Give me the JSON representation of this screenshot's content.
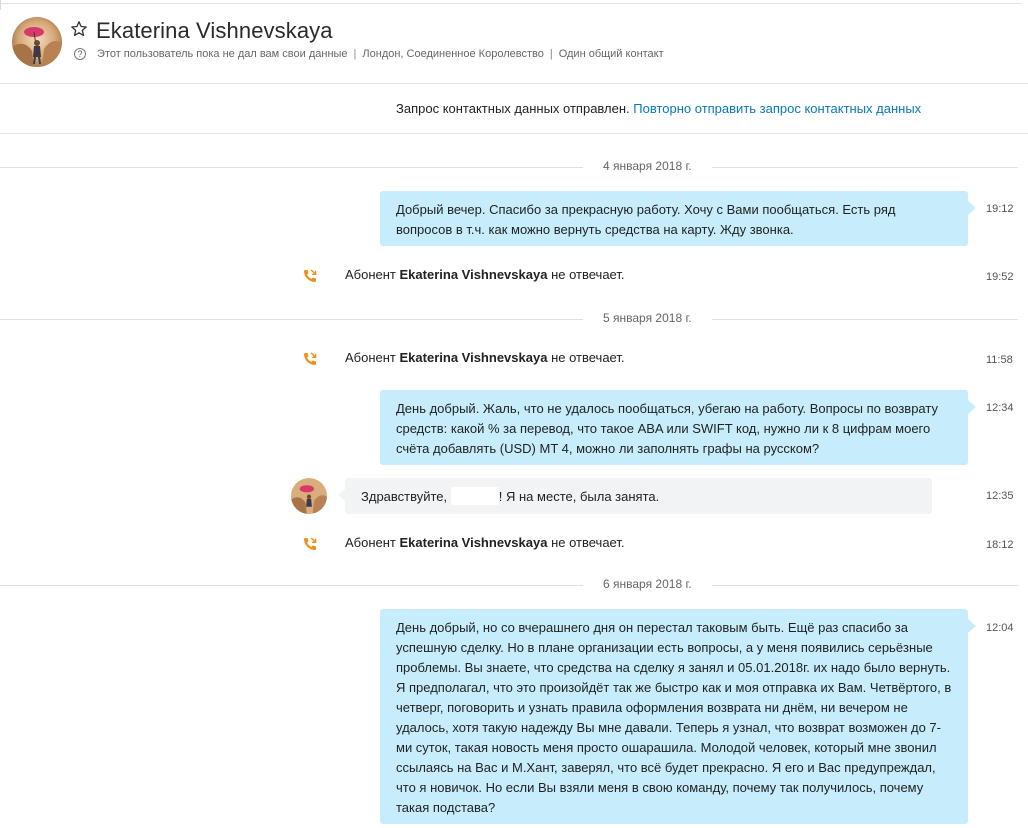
{
  "header": {
    "contact_name": "Ekaterina Vishnevskaya",
    "meta": {
      "privacy": "Этот пользователь пока не дал вам свои данные",
      "location": "Лондон, Соединенное Королевство",
      "shared": "Один общий контакт",
      "separator": "|"
    }
  },
  "request": {
    "status": "Запрос контактных данных отправлен.",
    "resend_link": "Повторно отправить запрос контактных данных"
  },
  "dates": [
    "4 января 2018 г.",
    "5 января 2018 г.",
    "6 января 2018 г."
  ],
  "messages": [
    {
      "type": "out",
      "text": "Добрый вечер. Спасибо за прекрасную работу. Хочу с Вами пообщаться. Есть ряд вопросов в т.ч.  как можно вернуть средства на карту. Жду звонка.",
      "time": "19:12"
    },
    {
      "type": "call",
      "prefix": "Абонент",
      "name": "Ekaterina Vishnevskaya",
      "suffix": "не отвечает.",
      "time": "19:52"
    },
    {
      "type": "call",
      "prefix": "Абонент",
      "name": "Ekaterina Vishnevskaya",
      "suffix": "не отвечает.",
      "time": "11:58"
    },
    {
      "type": "out",
      "text": "День добрый. Жаль, что не удалось пообщаться, убегаю на работу. Вопросы по возврату средств: какой % за перевод, что такое ABA или SWIFT код, нужно ли к 8 цифрам моего счёта добавлять (USD) MT 4, можно ли заполнять графы на русском?",
      "time": "12:34"
    },
    {
      "type": "in",
      "text_before": "Здравствуйте,",
      "text_after": "! Я на месте, была занята.",
      "time": "12:35"
    },
    {
      "type": "call",
      "prefix": "Абонент",
      "name": "Ekaterina Vishnevskaya",
      "suffix": "не отвечает.",
      "time": "18:12"
    },
    {
      "type": "out",
      "text": "День добрый, но со вчерашнего дня он перестал таковым быть. Ещё раз спасибо за успешную сделку. Но в плане организации есть вопросы, а у меня появились серьёзные проблемы. Вы знаете, что средства на сделку я занял и 05.01.2018г. их надо было вернуть. Я предполагал, что это произойдёт так же быстро как и моя отправка их Вам. Четвёртого, в четверг, поговорить и узнать правила оформления возврата ни днём, ни вечером не удалось, хотя такую надежду Вы мне давали. Теперь я узнал, что возврат возможен до 7-ми суток, такая новость меня просто ошарашила. Молодой человек, который мне звонил ссылаясь на Вас и М.Хант, заверял, что всё будет прекрасно. Я его и Вас предупреждал, что я новичок. Но если Вы взяли меня в свою команду, почему так получилось, почему такая подстава?",
      "time": "12:04"
    }
  ],
  "colors": {
    "bubble_out": "#c7edfc",
    "bubble_in": "#f1f3f5",
    "link": "#0a78b8",
    "call_icon": "#f0901a"
  },
  "icons": [
    "star-icon",
    "help-icon",
    "missed-call-icon",
    "avatar"
  ]
}
